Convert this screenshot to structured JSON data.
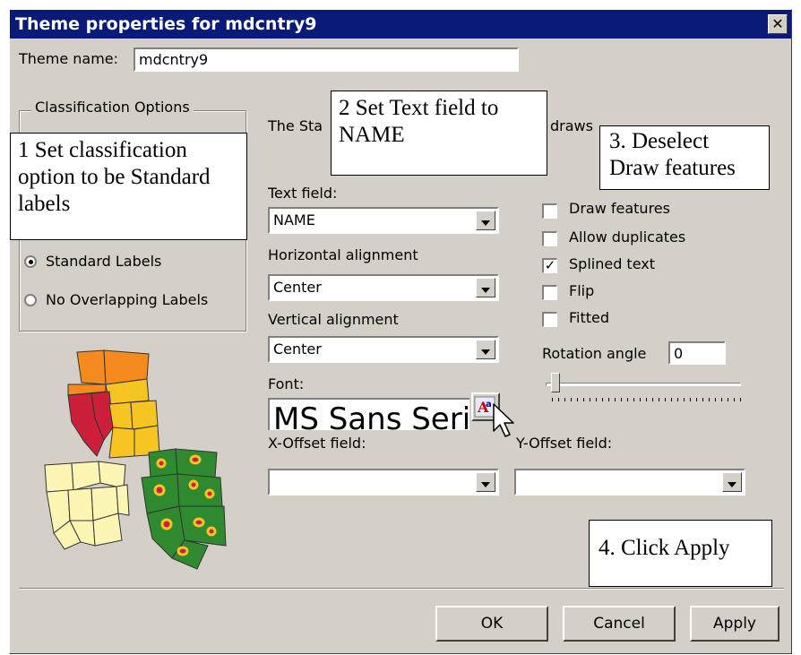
{
  "window": {
    "title": "Theme properties for mdcntry9",
    "close_glyph": "✕"
  },
  "theme_name": {
    "label": "Theme name:",
    "value": "mdcntry9"
  },
  "classification": {
    "group_title": "Classification Options",
    "options": [
      {
        "label": "Standard Labels",
        "selected": true
      },
      {
        "label": "No Overlapping Labels",
        "selected": false
      }
    ]
  },
  "description_partial": {
    "left": "The Sta",
    "right": "draws"
  },
  "text_field": {
    "label": "Text field:",
    "value": "NAME"
  },
  "horizontal_alignment": {
    "label": "Horizontal alignment",
    "value": "Center"
  },
  "vertical_alignment": {
    "label": "Vertical alignment",
    "value": "Center"
  },
  "font": {
    "label": "Font:",
    "preview": "MS Sans Serif"
  },
  "x_offset": {
    "label": "X-Offset field:",
    "value": ""
  },
  "y_offset": {
    "label": "Y-Offset field:",
    "value": ""
  },
  "options": [
    {
      "label": "Draw features",
      "checked": false
    },
    {
      "label": "Allow duplicates",
      "checked": false
    },
    {
      "label": "Splined text",
      "checked": true
    },
    {
      "label": "Flip",
      "checked": false
    },
    {
      "label": "Fitted",
      "checked": false
    }
  ],
  "check_glyph": "✓",
  "rotation": {
    "label": "Rotation angle",
    "value": "0",
    "slider_fraction": 0
  },
  "buttons": {
    "ok": "OK",
    "cancel": "Cancel",
    "apply": "Apply"
  },
  "callouts": {
    "step1": "1 Set classification option to be Standard labels",
    "step2": "2 Set Text field to NAME",
    "step3": "3. Deselect Draw features",
    "step4": "4. Click Apply"
  },
  "colors": {
    "titlebar": "#0a1a78",
    "dialog_bg": "#d4d0c8",
    "map_orange": "#f58a1f",
    "map_red": "#cc1f3a",
    "map_yellow": "#f7c521",
    "map_cream": "#fdf5b4",
    "map_green": "#2f8a2f"
  },
  "icons": {
    "font_button": "font-picker-icon",
    "cursor": "mouse-pointer-icon",
    "maps": "map-thumbnail-icon"
  }
}
